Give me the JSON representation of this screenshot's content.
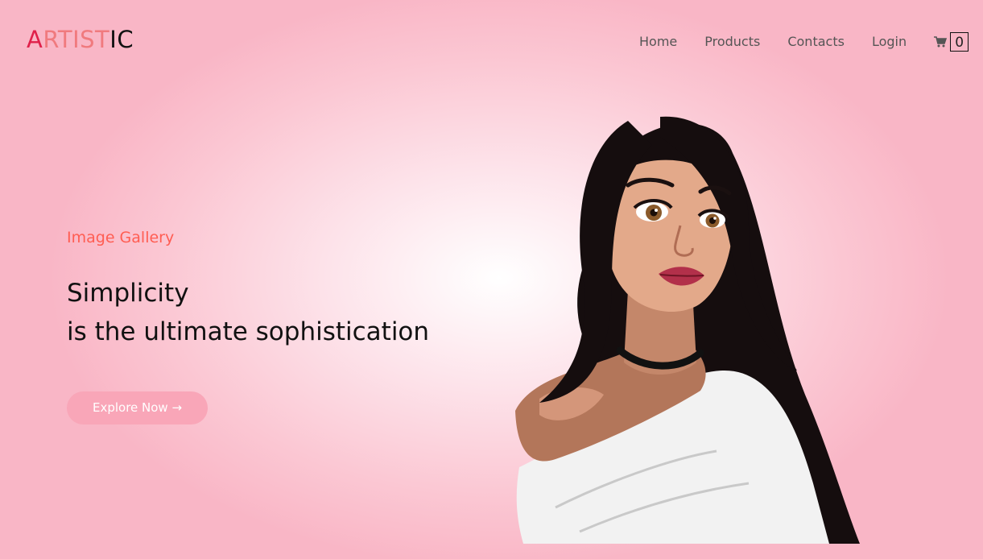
{
  "brand": {
    "logo_a": "A",
    "logo_rtist": "RTIST",
    "logo_ic": "IC",
    "colors": {
      "logo_red": "#e0204a",
      "logo_salmon": "#f07a7e",
      "accent": "#ff5d52",
      "button_pink": "#f9a6b8"
    }
  },
  "nav": {
    "items": [
      {
        "label": "Home"
      },
      {
        "label": "Products"
      },
      {
        "label": "Contacts"
      },
      {
        "label": "Login"
      }
    ],
    "cart": {
      "icon": "cart-icon",
      "count": "0"
    }
  },
  "hero": {
    "eyebrow": "Image Gallery",
    "headline_line1": "Simplicity",
    "headline_line2": "is the ultimate sophistication",
    "cta_label": "Explore Now →",
    "illustration": "cartoon-woman-illustration"
  }
}
